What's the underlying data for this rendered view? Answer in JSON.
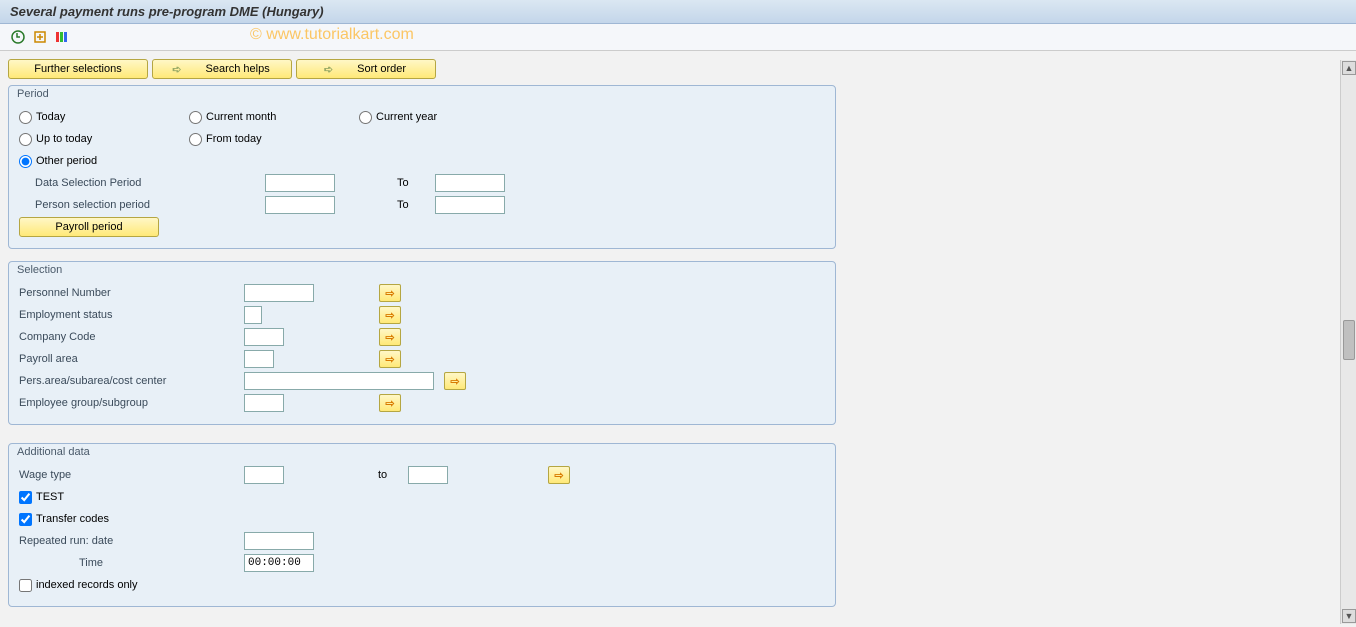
{
  "title": "Several payment runs pre-program DME (Hungary)",
  "watermark": "© www.tutorialkart.com",
  "buttons": {
    "further_selections": "Further selections",
    "search_helps": "Search helps",
    "sort_order": "Sort order",
    "payroll_period": "Payroll period"
  },
  "period": {
    "legend": "Period",
    "today": "Today",
    "current_month": "Current month",
    "current_year": "Current year",
    "up_to_today": "Up to today",
    "from_today": "From today",
    "other_period": "Other period",
    "data_selection_period": "Data Selection Period",
    "person_selection_period": "Person selection period",
    "to": "To",
    "selected": "other_period",
    "values": {
      "data_from": "",
      "data_to": "",
      "person_from": "",
      "person_to": ""
    }
  },
  "selection": {
    "legend": "Selection",
    "personnel_number": "Personnel Number",
    "employment_status": "Employment status",
    "company_code": "Company Code",
    "payroll_area": "Payroll area",
    "pers_area": "Pers.area/subarea/cost center",
    "employee_group": "Employee group/subgroup",
    "values": {
      "personnel_number": "",
      "employment_status": "",
      "company_code": "",
      "payroll_area": "",
      "pers_area": "",
      "employee_group": ""
    }
  },
  "additional": {
    "legend": "Additional data",
    "wage_type": "Wage type",
    "to": "to",
    "test": "TEST",
    "transfer_codes": "Transfer codes",
    "repeated_run": "Repeated run:   date",
    "time": "Time",
    "indexed_records": "indexed records only",
    "values": {
      "wage_type_from": "",
      "wage_type_to": "",
      "test_checked": true,
      "transfer_codes_checked": true,
      "repeated_date": "",
      "time": "00:00:00",
      "indexed_checked": false
    }
  }
}
